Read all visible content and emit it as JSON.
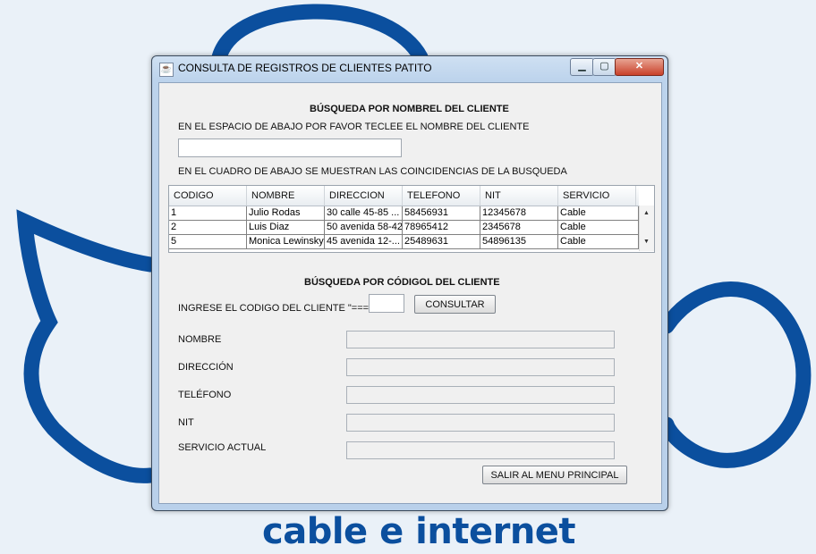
{
  "window": {
    "title": "CONSULTA DE REGISTROS DE CLIENTES PATITO",
    "controls": {
      "minimize": "▁",
      "maximize": "▢",
      "close": "✕"
    }
  },
  "name_search": {
    "heading": "BÚSQUEDA POR NOMBREL DEL CLIENTE",
    "instruction": "EN EL ESPACIO DE ABAJO POR FAVOR TECLEE EL NOMBRE DEL CLIENTE",
    "input_value": "",
    "results_caption": "EN EL CUADRO DE ABAJO SE MUESTRAN LAS COINCIDENCIAS DE LA BUSQUEDA"
  },
  "table": {
    "columns": [
      "CODIGO",
      "NOMBRE",
      "DIRECCION",
      "TELEFONO",
      "NIT",
      "SERVICIO"
    ],
    "rows": [
      [
        "1",
        "Julio Rodas",
        "30 calle 45-85 ...",
        "58456931",
        "12345678",
        "Cable"
      ],
      [
        "2",
        "Luis Diaz",
        "50 avenida 58-42",
        "78965412",
        "2345678",
        "Cable"
      ],
      [
        "5",
        "Monica Lewinsky",
        "45 avenida 12-...",
        "25489631",
        "54896135",
        "Cable"
      ]
    ]
  },
  "code_search": {
    "heading": "BÚSQUEDA POR CÓDIGOL DEL CLIENTE",
    "prompt": "INGRESE EL CODIGO DEL CLIENTE \"===>\"",
    "code_value": "",
    "consult_label": "CONSULTAR"
  },
  "details": {
    "nombre_label": "NOMBRE",
    "direccion_label": "DIRECCIÓN",
    "telefono_label": "TELÉFONO",
    "nit_label": "NIT",
    "servicio_label": "SERVICIO ACTUAL"
  },
  "exit_label": "SALIR AL MENU PRINCIPAL",
  "background": {
    "brand": "cable e internet",
    "brand_color": "#0b4f9e"
  }
}
